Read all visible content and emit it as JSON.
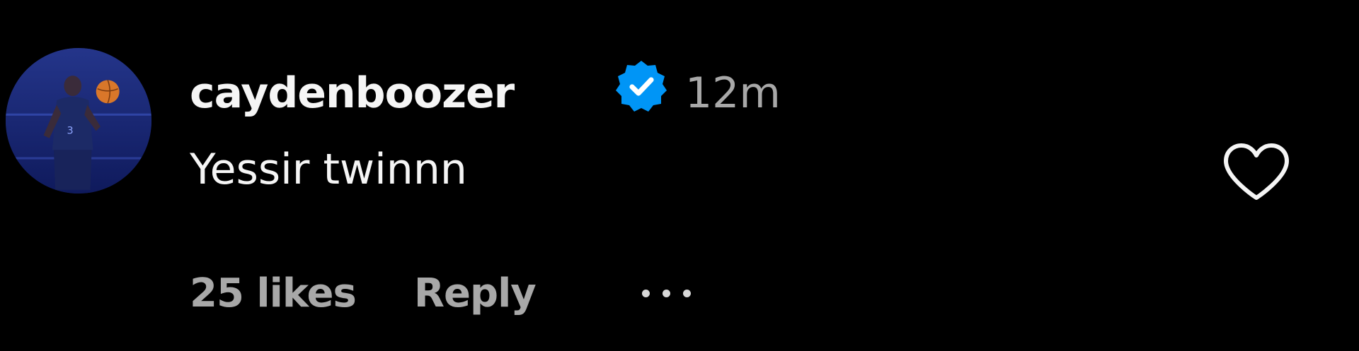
{
  "comment": {
    "username": "caydenboozer",
    "verified": true,
    "timestamp": "12m",
    "text": "Yessir twinnn",
    "likes_label": "25 likes",
    "reply_label": "Reply",
    "more_icon": "more-horizontal-icon",
    "like_icon": "heart-outline-icon",
    "verified_icon": "verified-badge-icon"
  },
  "colors": {
    "background": "#000000",
    "primary_text": "#f5f5f5",
    "secondary_text": "#a8a8a8",
    "verified_blue": "#0095f6"
  }
}
